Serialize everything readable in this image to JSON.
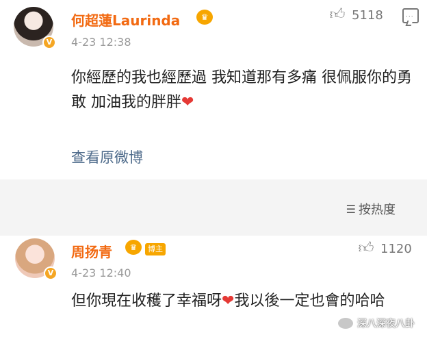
{
  "post": {
    "author": "何超蓮Laurinda",
    "time": "4-23 12:38",
    "likes": "5118",
    "text": "你經歷的我也經歷過 我知道那有多痛 很佩服你的勇敢 加油我的胖胖",
    "view_original": "查看原微博",
    "avatar_icon": "avatar-icon",
    "verified_badge": "V",
    "crown_icon": "crown-icon"
  },
  "sort": {
    "label": "按热度",
    "icon": "sort-icon"
  },
  "reply": {
    "author": "周扬青",
    "tag": "博主",
    "time": "4-23 12:40",
    "likes": "1120",
    "text_part1": "但你現在收穫了幸福呀",
    "text_part2": "我以後一定也會的哈哈",
    "verified_badge": "V"
  },
  "watermark": {
    "text": "深八深夜八卦"
  },
  "colors": {
    "name": "#f26a12",
    "link": "#4d6a8a",
    "crown": "#f7a600",
    "heart": "#e53935"
  }
}
